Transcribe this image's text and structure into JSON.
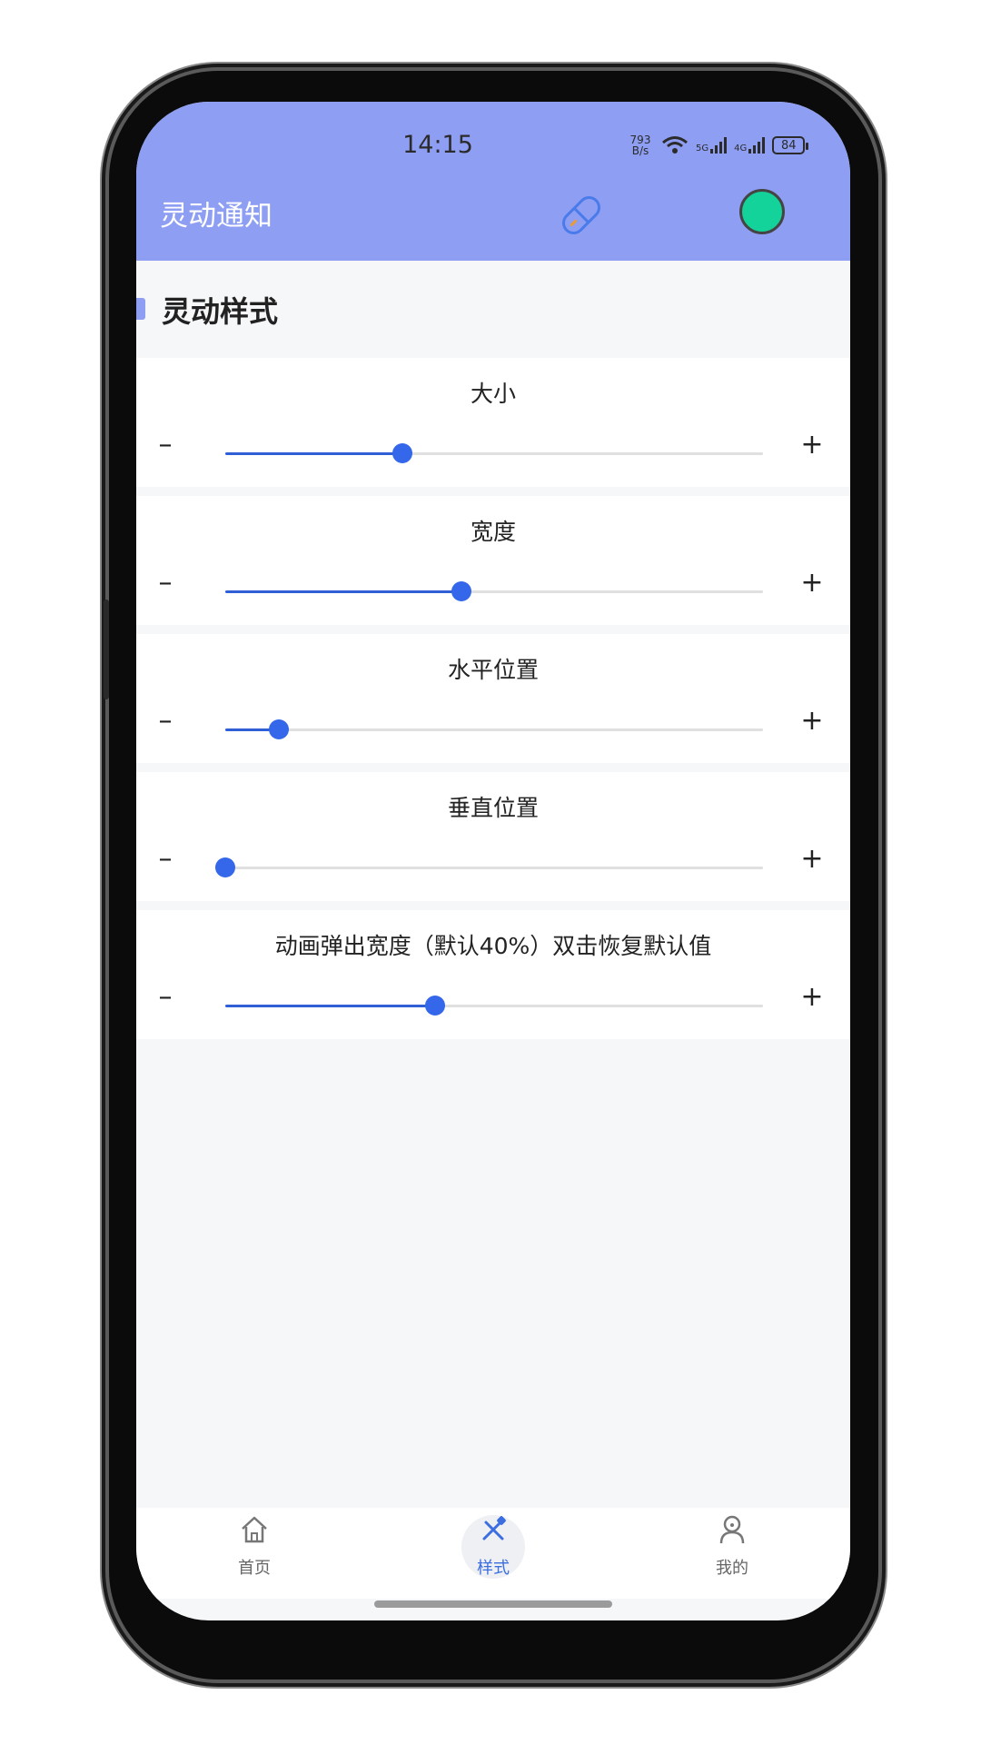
{
  "status_bar": {
    "time": "14:15",
    "net_speed_value": "793",
    "net_speed_unit": "B/s",
    "sim1": "5G",
    "sim2": "4G",
    "battery": "84"
  },
  "header": {
    "title": "灵动通知",
    "pill_icon": "pill-icon",
    "status_indicator_color": "#13d29a"
  },
  "section": {
    "title": "灵动样式"
  },
  "sliders": [
    {
      "label": "大小",
      "value": 0.33
    },
    {
      "label": "宽度",
      "value": 0.44
    },
    {
      "label": "水平位置",
      "value": 0.1
    },
    {
      "label": "垂直位置",
      "value": 0.0
    },
    {
      "label": "动画弹出宽度（默认40%）双击恢复默认值",
      "value": 0.39
    }
  ],
  "controls": {
    "minus": "–",
    "plus": "+"
  },
  "nav": [
    {
      "label": "首页",
      "icon": "home-icon"
    },
    {
      "label": "样式",
      "icon": "brush-icon",
      "active": true
    },
    {
      "label": "我的",
      "icon": "user-icon"
    }
  ],
  "colors": {
    "accent": "#3467ea",
    "header": "#8e9ef3"
  }
}
